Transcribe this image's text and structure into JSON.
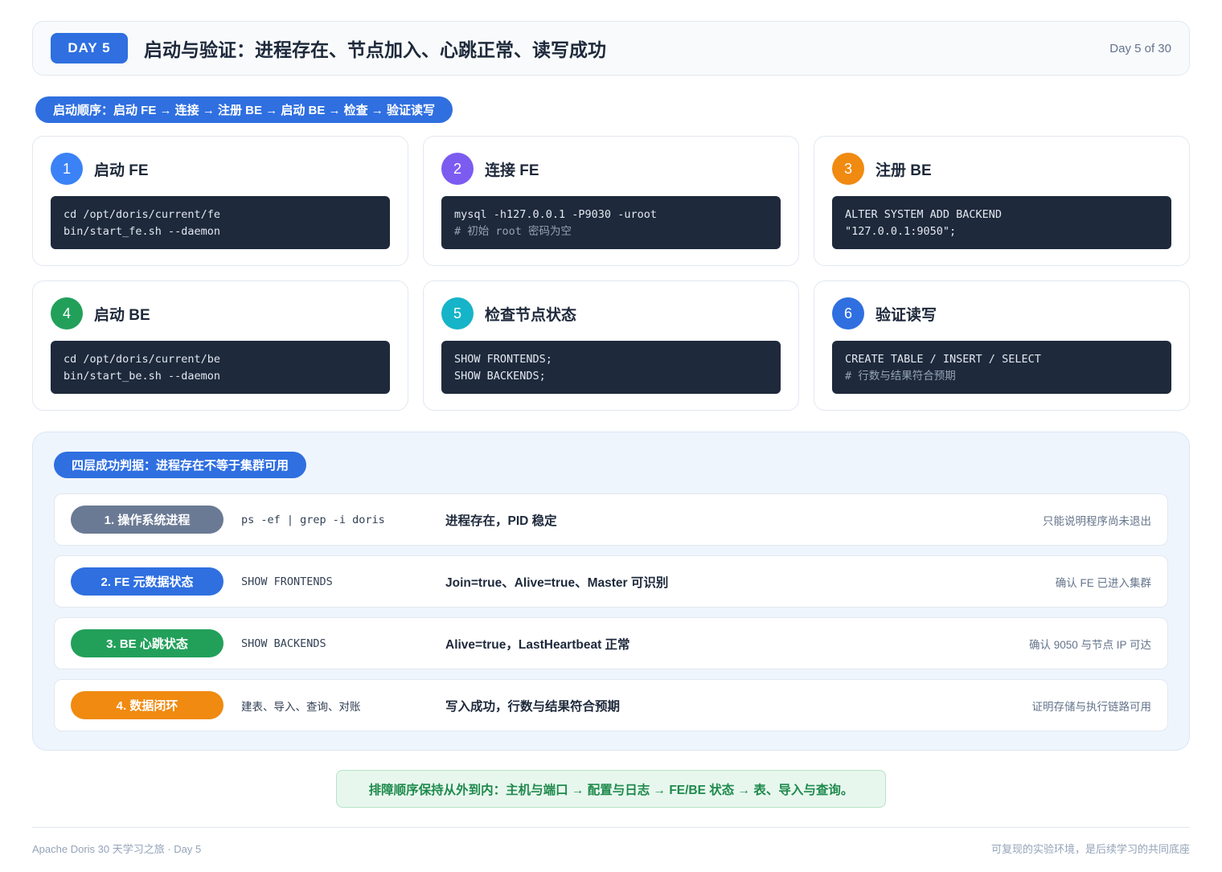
{
  "header": {
    "badge": "DAY 5",
    "title": "启动与验证：进程存在、节点加入、心跳正常、读写成功",
    "progress": "Day 5 of 30"
  },
  "startup": {
    "pill": "启动顺序：启动 FE → 连接 → 注册 BE → 启动 BE → 检查 → 验证读写",
    "steps": [
      {
        "num": "1",
        "title": "启动 FE",
        "color": "#3b82f6",
        "lines": [
          "cd /opt/doris/current/fe",
          "bin/start_fe.sh --daemon"
        ],
        "comment": ""
      },
      {
        "num": "2",
        "title": "连接 FE",
        "color": "#7c5cf0",
        "lines": [
          "mysql -h127.0.0.1 -P9030 -uroot"
        ],
        "comment": "# 初始 root 密码为空"
      },
      {
        "num": "3",
        "title": "注册 BE",
        "color": "#f08a10",
        "lines": [
          "ALTER SYSTEM ADD BACKEND",
          "\"127.0.0.1:9050\";"
        ],
        "comment": ""
      },
      {
        "num": "4",
        "title": "启动 BE",
        "color": "#22a05a",
        "lines": [
          "cd /opt/doris/current/be",
          "bin/start_be.sh --daemon"
        ],
        "comment": ""
      },
      {
        "num": "5",
        "title": "检查节点状态",
        "color": "#16b4c8",
        "lines": [
          "SHOW FRONTENDS;",
          "SHOW BACKENDS;"
        ],
        "comment": ""
      },
      {
        "num": "6",
        "title": "验证读写",
        "color": "#2f6fe0",
        "lines": [
          "CREATE TABLE / INSERT / SELECT"
        ],
        "comment": "# 行数与结果符合预期"
      }
    ]
  },
  "layers": {
    "pill": "四层成功判据：进程存在不等于集群可用",
    "rows": [
      {
        "label": "1. 操作系统进程",
        "color": "#6b7a94",
        "cmd": "ps -ef | grep -i doris",
        "result": "进程存在，PID 稳定",
        "note": "只能说明程序尚未退出"
      },
      {
        "label": "2. FE 元数据状态",
        "color": "#2f6fe0",
        "cmd": "SHOW FRONTENDS",
        "result": "Join=true、Alive=true、Master 可识别",
        "note": "确认 FE 已进入集群"
      },
      {
        "label": "3. BE 心跳状态",
        "color": "#22a05a",
        "cmd": "SHOW BACKENDS",
        "result": "Alive=true，LastHeartbeat 正常",
        "note": "确认 9050 与节点 IP 可达"
      },
      {
        "label": "4. 数据闭环",
        "color": "#f08a10",
        "cmd": "建表、导入、查询、对账",
        "result": "写入成功，行数与结果符合预期",
        "note": "证明存储与执行链路可用"
      }
    ]
  },
  "tip": "排障顺序保持从外到内：主机与端口 → 配置与日志 → FE/BE 状态 → 表、导入与查询。",
  "footer": {
    "left": "Apache Doris 30 天学习之旅 · Day 5",
    "right": "可复现的实验环境，是后续学习的共同底座"
  }
}
